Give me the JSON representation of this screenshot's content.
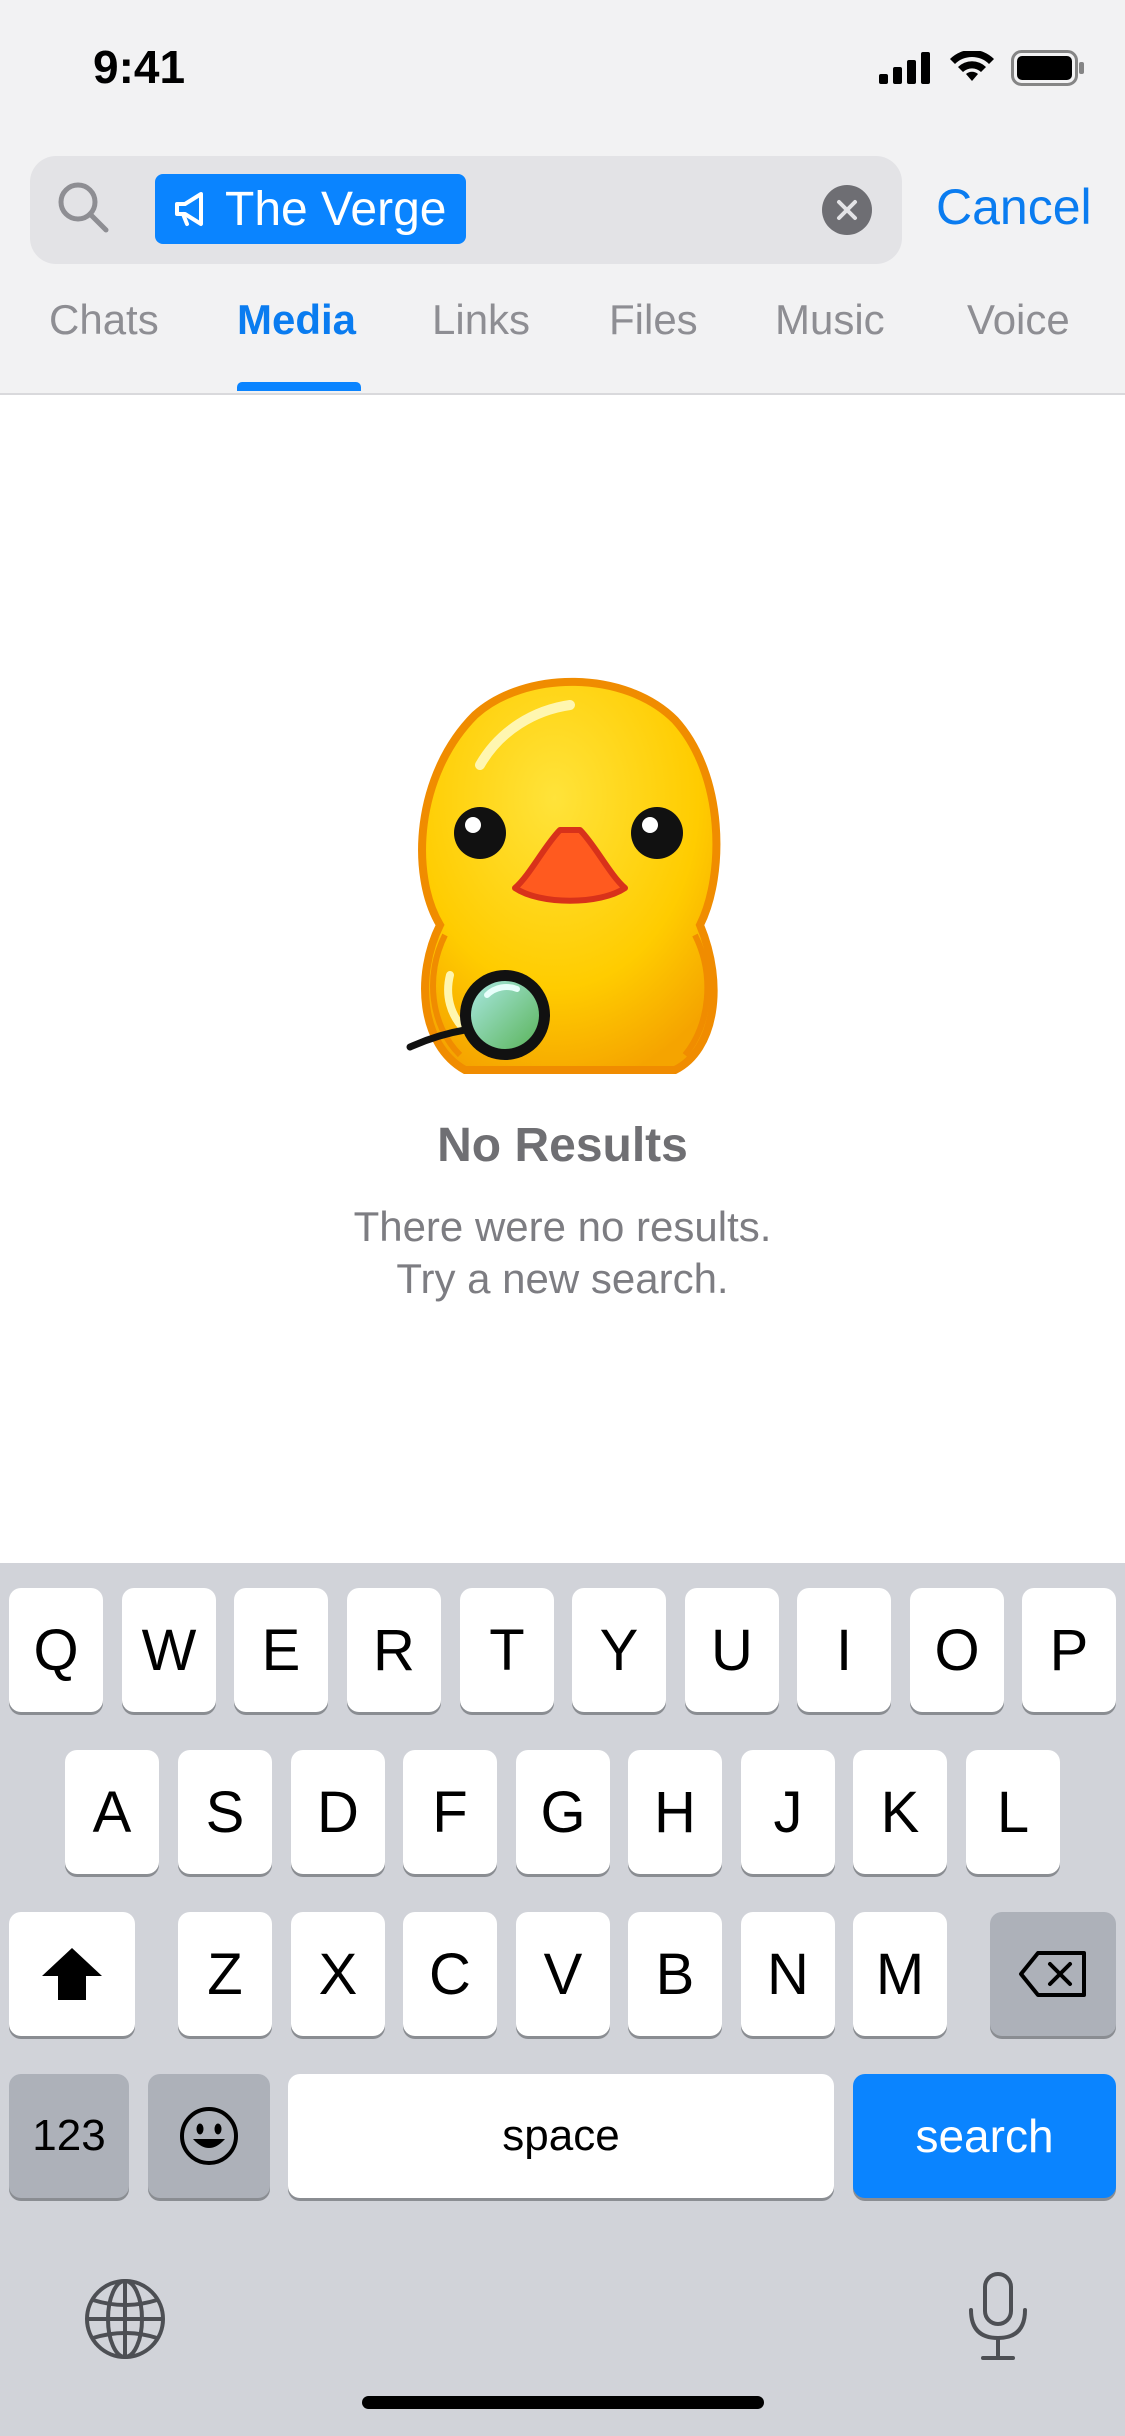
{
  "status_bar": {
    "time": "9:41"
  },
  "search": {
    "token_label": "The Verge",
    "cancel_label": "Cancel"
  },
  "tabs": [
    {
      "label": "Chats"
    },
    {
      "label": "Media",
      "active": true
    },
    {
      "label": "Links"
    },
    {
      "label": "Files"
    },
    {
      "label": "Music"
    },
    {
      "label": "Voice"
    }
  ],
  "empty_state": {
    "title": "No Results",
    "line1": "There were no results.",
    "line2": "Try a new search."
  },
  "keyboard": {
    "row1": [
      "Q",
      "W",
      "E",
      "R",
      "T",
      "Y",
      "U",
      "I",
      "O",
      "P"
    ],
    "row2": [
      "A",
      "S",
      "D",
      "F",
      "G",
      "H",
      "J",
      "K",
      "L"
    ],
    "row3": [
      "Z",
      "X",
      "C",
      "V",
      "B",
      "N",
      "M"
    ],
    "numbers_label": "123",
    "space_label": "space",
    "search_label": "search"
  },
  "colors": {
    "accent": "#0a84ff",
    "keyboard_bg": "#d1d3d9"
  },
  "icons": [
    "search-icon",
    "megaphone-icon",
    "clear-icon",
    "shift-icon",
    "backspace-icon",
    "emoji-icon",
    "globe-icon",
    "microphone-icon",
    "signal-icon",
    "wifi-icon",
    "battery-icon"
  ]
}
